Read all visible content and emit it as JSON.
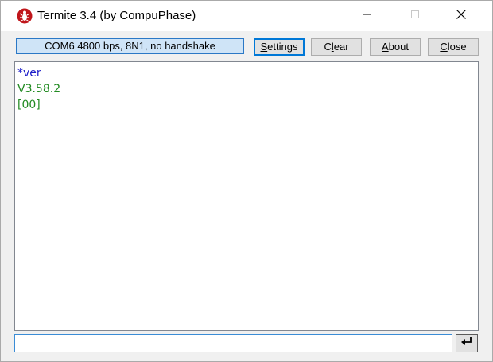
{
  "window": {
    "title": "Termite 3.4 (by CompuPhase)"
  },
  "toolbar": {
    "status": "COM6 4800 bps, 8N1, no handshake",
    "settings": {
      "pre": "",
      "ul": "S",
      "post": "ettings"
    },
    "clear": {
      "pre": "C",
      "ul": "l",
      "post": "ear"
    },
    "about": {
      "pre": "",
      "ul": "A",
      "post": "bout"
    },
    "close": {
      "pre": "",
      "ul": "C",
      "post": "lose"
    }
  },
  "terminal": {
    "lines": [
      {
        "text": "*ver",
        "color": "#1a1ac8"
      },
      {
        "text": "V3.58.2",
        "color": "#228b22"
      },
      {
        "text": "[00]",
        "color": "#228b22"
      }
    ]
  },
  "input": {
    "value": ""
  },
  "icons": {
    "app": "termite-bug-icon",
    "send": "enter-return-icon"
  },
  "colors": {
    "status_bg": "#cfe4f7",
    "echo": "#1a1ac8",
    "received": "#228b22"
  }
}
